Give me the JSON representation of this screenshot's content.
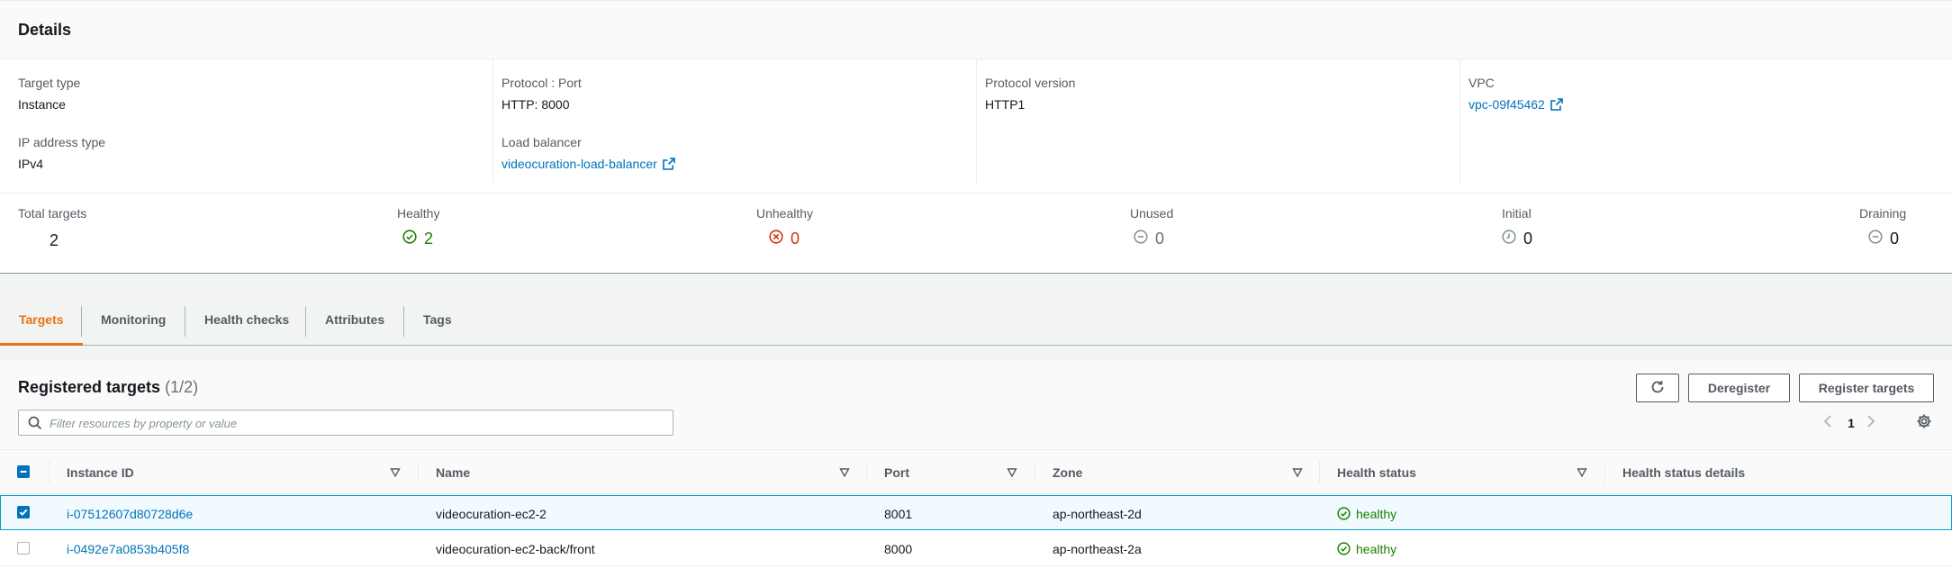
{
  "details": {
    "title": "Details",
    "target_type_label": "Target type",
    "target_type_value": "Instance",
    "ip_type_label": "IP address type",
    "ip_type_value": "IPv4",
    "protocol_port_label": "Protocol : Port",
    "protocol_port_value": "HTTP: 8000",
    "load_balancer_label": "Load balancer",
    "load_balancer_value": "videocuration-load-balancer",
    "protocol_version_label": "Protocol version",
    "protocol_version_value": "HTTP1",
    "vpc_label": "VPC",
    "vpc_value": "vpc-09f45462"
  },
  "stats": {
    "total_label": "Total targets",
    "total_value": "2",
    "healthy_label": "Healthy",
    "healthy_value": "2",
    "unhealthy_label": "Unhealthy",
    "unhealthy_value": "0",
    "unused_label": "Unused",
    "unused_value": "0",
    "initial_label": "Initial",
    "initial_value": "0",
    "draining_label": "Draining",
    "draining_value": "0"
  },
  "tabs": [
    "Targets",
    "Monitoring",
    "Health checks",
    "Attributes",
    "Tags"
  ],
  "active_tab": "Targets",
  "registered": {
    "title": "Registered targets",
    "count": "(1/2)",
    "deregister_label": "Deregister",
    "register_label": "Register targets",
    "filter_placeholder": "Filter resources by property or value",
    "page_number": "1"
  },
  "table": {
    "columns": [
      "Instance ID",
      "Name",
      "Port",
      "Zone",
      "Health status",
      "Health status details"
    ],
    "rows": [
      {
        "instance_id": "i-07512607d80728d6e",
        "name": "videocuration-ec2-2",
        "port": "8001",
        "zone": "ap-northeast-2d",
        "health": "healthy",
        "details": "",
        "selected": true
      },
      {
        "instance_id": "i-0492e7a0853b405f8",
        "name": "videocuration-ec2-back/front",
        "port": "8000",
        "zone": "ap-northeast-2a",
        "health": "healthy",
        "details": "",
        "selected": false
      }
    ]
  },
  "colors": {
    "accent_orange": "#ec7211",
    "link_blue": "#0073bb",
    "healthy_green": "#1d8102",
    "unhealthy_red": "#d13212",
    "selected_border": "#00a1c9"
  },
  "icons": {
    "healthy": "check-circle-icon",
    "unhealthy": "x-circle-icon",
    "unused": "minus-circle-icon",
    "initial": "clock-icon",
    "draining": "minus-circle-icon",
    "external": "external-link-icon",
    "refresh": "refresh-icon",
    "settings": "gear-icon",
    "search": "search-icon"
  }
}
